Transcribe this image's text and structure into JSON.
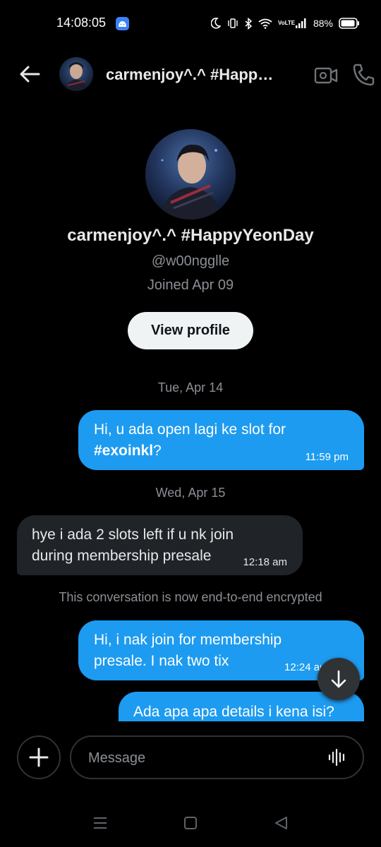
{
  "status_bar": {
    "time": "14:08:05",
    "battery": "88%",
    "network_label": "VoLTE",
    "icons": [
      "moon-icon",
      "vibrate-icon",
      "bluetooth-icon",
      "wifi-icon",
      "volte-icon",
      "signal-icon",
      "battery-icon"
    ]
  },
  "header": {
    "name": "carmenjoy^.^ #HappyYeonDay",
    "icons": [
      "back-arrow-icon",
      "video-call-icon",
      "phone-call-icon"
    ]
  },
  "profile": {
    "name": "carmenjoy^.^ #HappyYeonDay",
    "handle": "@w00ngglle",
    "joined": "Joined Apr 09",
    "view_button": "View profile"
  },
  "conversation": {
    "dates": [
      "Tue, Apr 14",
      "Wed, Apr 15"
    ],
    "encryption_notice": "This conversation is now end-to-end encrypted",
    "messages": [
      {
        "direction": "out",
        "text": "Hi, u ada open lagi ke slot for",
        "hashtag": "#exoinkl",
        "suffix": "?",
        "time": "11:59 pm"
      },
      {
        "direction": "in",
        "line1": "hye i ada 2 slots left if u nk join",
        "line2": "during membership presale",
        "time": "12:18 am"
      },
      {
        "direction": "out",
        "line1": "Hi, i nak join for membership",
        "line2": "presale. I nak two tix",
        "time": "12:24 am"
      },
      {
        "direction": "out",
        "text": "Ada apa apa details i kena isi?"
      }
    ]
  },
  "composer": {
    "placeholder": "Message",
    "icons": [
      "plus-icon",
      "voice-waveform-icon"
    ]
  },
  "scroll_button": {
    "icon": "arrow-down-icon"
  },
  "nav_bar": {
    "icons": [
      "recent-apps-icon",
      "home-icon",
      "back-icon"
    ]
  },
  "colors": {
    "background": "#000000",
    "outgoing_bubble": "#1d9bf0",
    "incoming_bubble": "#202327",
    "muted_text": "#8b8f94",
    "primary_text": "#e7e9ea"
  }
}
